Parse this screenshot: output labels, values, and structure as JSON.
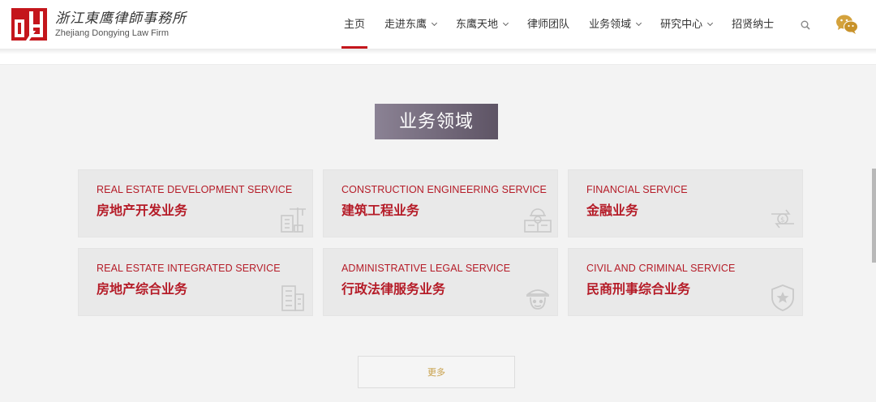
{
  "brand": {
    "name_cn": "浙江東鹰律師事務所",
    "name_en": "Zhejiang Dongying Law Firm",
    "accent": "#c4161c"
  },
  "nav": {
    "items": [
      {
        "label": "主页",
        "active": true,
        "dropdown": false
      },
      {
        "label": "走进东鹰",
        "active": false,
        "dropdown": true
      },
      {
        "label": "东鹰天地",
        "active": false,
        "dropdown": true
      },
      {
        "label": "律师团队",
        "active": false,
        "dropdown": false
      },
      {
        "label": "业务领域",
        "active": false,
        "dropdown": true
      },
      {
        "label": "研究中心",
        "active": false,
        "dropdown": true
      },
      {
        "label": "招贤纳士",
        "active": false,
        "dropdown": false
      }
    ],
    "search_icon": "search-icon",
    "wechat_icon": "wechat-icon"
  },
  "section": {
    "title": "业务领域"
  },
  "services": [
    {
      "en": "REAL ESTATE DEVELOPMENT SERVICE",
      "cn": "房地产开发业务",
      "icon": "crane-building-icon"
    },
    {
      "en": "CONSTRUCTION ENGINEERING SERVICE",
      "cn": "建筑工程业务",
      "icon": "engineer-blueprint-icon"
    },
    {
      "en": "FINANCIAL SERVICE",
      "cn": "金融业务",
      "icon": "money-exchange-icon"
    },
    {
      "en": "REAL ESTATE INTEGRATED SERVICE",
      "cn": "房地产综合业务",
      "icon": "office-building-icon"
    },
    {
      "en": "ADMINISTRATIVE LEGAL SERVICE",
      "cn": "行政法律服务业务",
      "icon": "officer-icon"
    },
    {
      "en": "CIVIL AND CRIMINAL SERVICE",
      "cn": "民商刑事综合业务",
      "icon": "shield-star-icon"
    }
  ],
  "more_button": {
    "label": "更多"
  }
}
